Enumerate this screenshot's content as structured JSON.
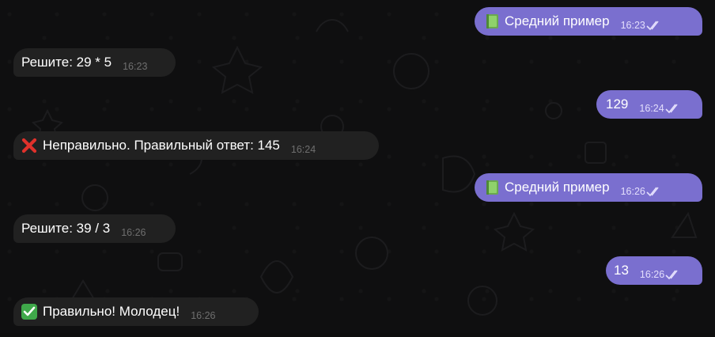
{
  "messages": [
    {
      "side": "out",
      "icon": "green-book-emoji",
      "text": "Средний пример",
      "time": "16:23"
    },
    {
      "side": "in",
      "icon": "",
      "text": "Решите: 29 * 5",
      "time": "16:23"
    },
    {
      "side": "out",
      "icon": "",
      "text": "129",
      "time": "16:24"
    },
    {
      "side": "in",
      "icon": "red-cross-emoji",
      "text": "Неправильно. Правильный ответ: 145",
      "time": "16:24"
    },
    {
      "side": "out",
      "icon": "green-book-emoji",
      "text": "Средний пример",
      "time": "16:26"
    },
    {
      "side": "in",
      "icon": "",
      "text": "Решите: 39 / 3",
      "time": "16:26"
    },
    {
      "side": "out",
      "icon": "",
      "text": "13",
      "time": "16:26"
    },
    {
      "side": "in",
      "icon": "check-mark-emoji",
      "text": "Правильно! Молодец!",
      "time": "16:26"
    }
  ],
  "colors": {
    "background": "#0f0f10",
    "incoming_bubble": "#212121",
    "outgoing_bubble": "#7a6fcf"
  }
}
